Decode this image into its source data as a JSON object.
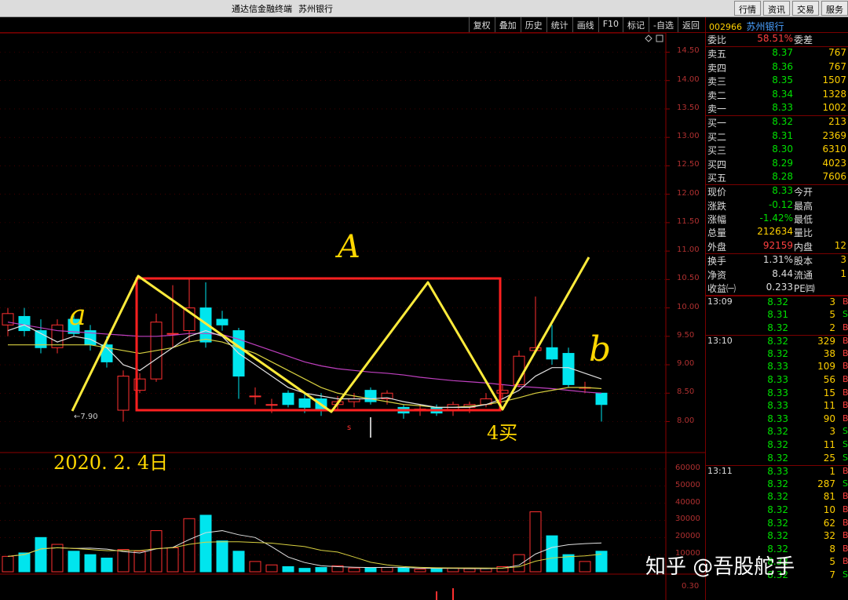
{
  "window": {
    "title": "通达信金融终端",
    "stock_title": "苏州银行"
  },
  "top_buttons": [
    "行情",
    "资讯",
    "交易",
    "服务"
  ],
  "toolbar": [
    "复权",
    "叠加",
    "历史",
    "统计",
    "画线",
    "F10",
    "标记",
    "-自选",
    "返回"
  ],
  "price_axis": [
    "14.50",
    "14.00",
    "13.50",
    "13.00",
    "12.50",
    "12.00",
    "11.50",
    "11.00",
    "10.50",
    "10.00",
    "9.50",
    "9.00",
    "8.50",
    "8.00"
  ],
  "volume_axis": [
    "60000",
    "50000",
    "40000",
    "30000",
    "20000",
    "10000"
  ],
  "bottom_axis": [
    "0.30"
  ],
  "low_marker": "←7.90",
  "annotations": {
    "A": "A",
    "a": "a",
    "b": "b",
    "buy": "4买",
    "date": "2020. 2. 4日"
  },
  "watermark": "知乎 @吾股舵手",
  "quote": {
    "code": "002966",
    "name": "苏州银行",
    "ratio_label": "委比",
    "ratio_value": "58.51%",
    "diff_label": "委差",
    "sell": [
      {
        "label": "卖五",
        "price": "8.37",
        "qty": "767"
      },
      {
        "label": "卖四",
        "price": "8.36",
        "qty": "767"
      },
      {
        "label": "卖三",
        "price": "8.35",
        "qty": "1507"
      },
      {
        "label": "卖二",
        "price": "8.34",
        "qty": "1328"
      },
      {
        "label": "卖一",
        "price": "8.33",
        "qty": "1002"
      }
    ],
    "buy": [
      {
        "label": "买一",
        "price": "8.32",
        "qty": "213"
      },
      {
        "label": "买二",
        "price": "8.31",
        "qty": "2369"
      },
      {
        "label": "买三",
        "price": "8.30",
        "qty": "6310"
      },
      {
        "label": "买四",
        "price": "8.29",
        "qty": "4023"
      },
      {
        "label": "买五",
        "price": "8.28",
        "qty": "7606"
      }
    ],
    "stats": [
      {
        "l": "现价",
        "v": "8.33",
        "c": "g",
        "l2": "今开"
      },
      {
        "l": "涨跌",
        "v": "-0.12",
        "c": "g",
        "l2": "最高"
      },
      {
        "l": "涨幅",
        "v": "-1.42%",
        "c": "g",
        "l2": "最低"
      },
      {
        "l": "总量",
        "v": "212634",
        "c": "y",
        "l2": "量比"
      },
      {
        "l": "外盘",
        "v": "92159",
        "c": "r",
        "l2": "内盘",
        "q": "12"
      }
    ],
    "stats2": [
      {
        "l": "换手",
        "v": "1.31%",
        "c": "w",
        "l2": "股本",
        "q": "3"
      },
      {
        "l": "净资",
        "v": "8.44",
        "c": "w",
        "l2": "流通",
        "q": "1"
      },
      {
        "l": "收益㈠",
        "v": "0.233",
        "c": "w",
        "l2": "PE㈣"
      }
    ]
  },
  "ticks": [
    {
      "t": "13:09",
      "p": "8.32",
      "n": "3",
      "f": "B",
      "c": "g"
    },
    {
      "t": "",
      "p": "8.31",
      "n": "5",
      "f": "S",
      "c": "g"
    },
    {
      "t": "",
      "p": "8.32",
      "n": "2",
      "f": "B",
      "c": "g"
    },
    {
      "t": "13:10",
      "p": "8.32",
      "n": "329",
      "f": "B",
      "c": "g"
    },
    {
      "t": "",
      "p": "8.32",
      "n": "38",
      "f": "B",
      "c": "g"
    },
    {
      "t": "",
      "p": "8.33",
      "n": "109",
      "f": "B",
      "c": "g"
    },
    {
      "t": "",
      "p": "8.33",
      "n": "56",
      "f": "B",
      "c": "g"
    },
    {
      "t": "",
      "p": "8.33",
      "n": "15",
      "f": "B",
      "c": "g"
    },
    {
      "t": "",
      "p": "8.33",
      "n": "11",
      "f": "B",
      "c": "g"
    },
    {
      "t": "",
      "p": "8.33",
      "n": "90",
      "f": "B",
      "c": "g"
    },
    {
      "t": "",
      "p": "8.32",
      "n": "3",
      "f": "S",
      "c": "g"
    },
    {
      "t": "",
      "p": "8.32",
      "n": "11",
      "f": "S",
      "c": "g"
    },
    {
      "t": "",
      "p": "8.32",
      "n": "25",
      "f": "S",
      "c": "g"
    },
    {
      "t": "13:11",
      "p": "8.33",
      "n": "1",
      "f": "B",
      "c": "g"
    },
    {
      "t": "",
      "p": "8.32",
      "n": "287",
      "f": "S",
      "c": "g"
    },
    {
      "t": "",
      "p": "8.32",
      "n": "81",
      "f": "B",
      "c": "g"
    },
    {
      "t": "",
      "p": "8.32",
      "n": "10",
      "f": "B",
      "c": "g"
    },
    {
      "t": "",
      "p": "8.32",
      "n": "62",
      "f": "B",
      "c": "g"
    },
    {
      "t": "",
      "p": "8.32",
      "n": "32",
      "f": "B",
      "c": "g"
    },
    {
      "t": "",
      "p": "8.32",
      "n": "8",
      "f": "B",
      "c": "g"
    },
    {
      "t": "",
      "p": "8.32",
      "n": "5",
      "f": "B",
      "c": "g"
    },
    {
      "t": "",
      "p": "8.32",
      "n": "7",
      "f": "S",
      "c": "g"
    }
  ],
  "chart_data": {
    "type": "candlestick",
    "ylim": [
      7.8,
      14.7
    ],
    "candles": [
      {
        "o": 9.7,
        "c": 9.9,
        "h": 10.0,
        "l": 9.5
      },
      {
        "o": 9.85,
        "c": 9.6,
        "h": 10.0,
        "l": 9.5
      },
      {
        "o": 9.6,
        "c": 9.3,
        "h": 9.8,
        "l": 9.2
      },
      {
        "o": 9.3,
        "c": 9.7,
        "h": 9.8,
        "l": 9.2
      },
      {
        "o": 9.8,
        "c": 9.55,
        "h": 9.9,
        "l": 9.5
      },
      {
        "o": 9.6,
        "c": 9.35,
        "h": 9.7,
        "l": 9.25
      },
      {
        "o": 9.35,
        "c": 9.05,
        "h": 9.5,
        "l": 8.95
      },
      {
        "o": 8.2,
        "c": 8.8,
        "h": 8.9,
        "l": 8.0
      },
      {
        "o": 8.55,
        "c": 8.75,
        "h": 8.85,
        "l": 8.5
      },
      {
        "o": 8.75,
        "c": 9.75,
        "h": 9.9,
        "l": 8.7
      },
      {
        "o": 9.55,
        "c": 9.55,
        "h": 10.4,
        "l": 9.3
      },
      {
        "o": 9.6,
        "c": 10.0,
        "h": 10.5,
        "l": 9.4
      },
      {
        "o": 10.0,
        "c": 9.4,
        "h": 10.45,
        "l": 9.3
      },
      {
        "o": 9.8,
        "c": 9.7,
        "h": 9.95,
        "l": 9.6
      },
      {
        "o": 9.6,
        "c": 8.8,
        "h": 9.65,
        "l": 8.4
      },
      {
        "o": 8.45,
        "c": 8.45,
        "h": 8.6,
        "l": 8.3
      },
      {
        "o": 8.3,
        "c": 8.3,
        "h": 8.4,
        "l": 8.15
      },
      {
        "o": 8.5,
        "c": 8.3,
        "h": 8.55,
        "l": 8.25
      },
      {
        "o": 8.4,
        "c": 8.25,
        "h": 8.5,
        "l": 8.15
      },
      {
        "o": 8.4,
        "c": 8.2,
        "h": 8.5,
        "l": 8.1
      },
      {
        "o": 8.3,
        "c": 8.35,
        "h": 8.45,
        "l": 8.2
      },
      {
        "o": 8.35,
        "c": 8.4,
        "h": 8.5,
        "l": 8.25
      },
      {
        "o": 8.55,
        "c": 8.35,
        "h": 8.6,
        "l": 8.3
      },
      {
        "o": 8.4,
        "c": 8.5,
        "h": 8.55,
        "l": 8.3
      },
      {
        "o": 8.25,
        "c": 8.15,
        "h": 8.3,
        "l": 8.05
      },
      {
        "o": 8.2,
        "c": 8.22,
        "h": 8.3,
        "l": 8.1
      },
      {
        "o": 8.25,
        "c": 8.15,
        "h": 8.3,
        "l": 8.1
      },
      {
        "o": 8.2,
        "c": 8.3,
        "h": 8.35,
        "l": 8.1
      },
      {
        "o": 8.25,
        "c": 8.3,
        "h": 8.35,
        "l": 8.15
      },
      {
        "o": 8.3,
        "c": 8.4,
        "h": 8.5,
        "l": 8.25
      },
      {
        "o": 8.5,
        "c": 8.55,
        "h": 8.65,
        "l": 8.4
      },
      {
        "o": 8.65,
        "c": 9.15,
        "h": 9.25,
        "l": 8.6
      },
      {
        "o": 9.25,
        "c": 9.3,
        "h": 10.2,
        "l": 9.2
      },
      {
        "o": 9.3,
        "c": 9.1,
        "h": 9.7,
        "l": 9.0
      },
      {
        "o": 9.2,
        "c": 8.65,
        "h": 9.3,
        "l": 8.6
      },
      {
        "o": 8.6,
        "c": 8.6,
        "h": 8.7,
        "l": 8.5
      },
      {
        "o": 8.5,
        "c": 8.3,
        "h": 8.5,
        "l": 8.0
      }
    ],
    "ma_white": [
      9.6,
      9.7,
      9.55,
      9.4,
      9.5,
      9.45,
      9.3,
      9.0,
      8.9,
      9.1,
      9.3,
      9.5,
      9.6,
      9.5,
      9.2,
      9.0,
      8.8,
      8.6,
      8.5,
      8.45,
      8.4,
      8.4,
      8.4,
      8.42,
      8.35,
      8.3,
      8.25,
      8.25,
      8.25,
      8.3,
      8.4,
      8.55,
      8.8,
      8.95,
      8.95,
      8.85,
      8.75
    ],
    "ma_yellow": [
      9.35,
      9.35,
      9.35,
      9.35,
      9.35,
      9.35,
      9.3,
      9.25,
      9.2,
      9.25,
      9.3,
      9.4,
      9.45,
      9.4,
      9.3,
      9.2,
      9.05,
      8.9,
      8.75,
      8.6,
      8.5,
      8.45,
      8.4,
      8.35,
      8.3,
      8.28,
      8.25,
      8.25,
      8.27,
      8.3,
      8.35,
      8.42,
      8.5,
      8.55,
      8.6,
      8.6,
      8.58
    ],
    "ma_magenta": [
      9.75,
      9.7,
      9.65,
      9.6,
      9.58,
      9.56,
      9.54,
      9.52,
      9.5,
      9.5,
      9.52,
      9.55,
      9.55,
      9.53,
      9.45,
      9.35,
      9.25,
      9.15,
      9.05,
      8.98,
      8.93,
      8.9,
      8.87,
      8.85,
      8.82,
      8.78,
      8.75,
      8.72,
      8.7,
      8.68,
      8.65,
      8.62,
      8.6,
      8.58,
      8.55,
      8.52,
      8.5
    ],
    "volume": [
      9000,
      11000,
      20000,
      16000,
      12000,
      10000,
      8000,
      13000,
      12000,
      24000,
      14000,
      31000,
      33000,
      18000,
      12000,
      6000,
      4000,
      3000,
      2000,
      2500,
      3500,
      2200,
      2200,
      2500,
      2300,
      1500,
      1600,
      2200,
      1800,
      2000,
      3000,
      10000,
      35000,
      21000,
      10000,
      6000,
      12000
    ]
  }
}
